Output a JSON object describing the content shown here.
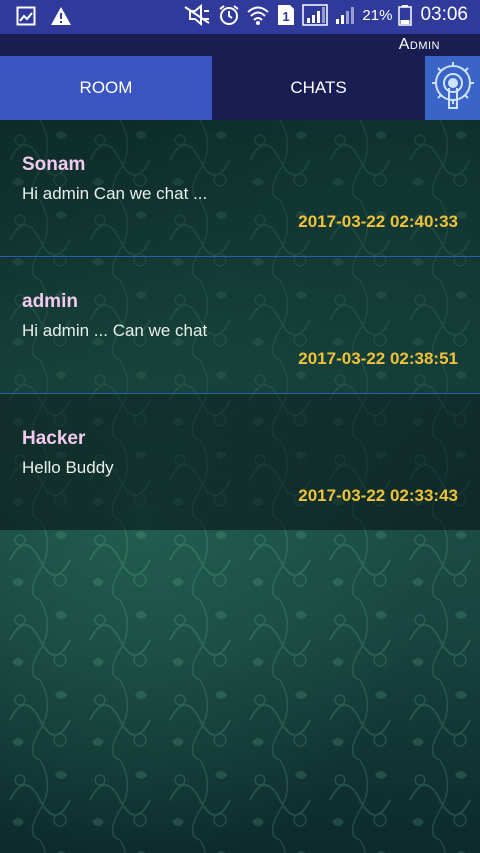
{
  "status_bar": {
    "battery_percent": "21%",
    "clock": "03:06",
    "sim_label": "1",
    "icons": [
      "image-notification-icon",
      "warning-icon",
      "mute-icon",
      "alarm-icon",
      "wifi-icon",
      "sim-icon",
      "signal-icon",
      "battery-icon"
    ]
  },
  "header": {
    "user_name": "Admin"
  },
  "tabs": [
    {
      "label": "ROOM",
      "active": true
    },
    {
      "label": "CHATS",
      "active": false
    }
  ],
  "settings": {
    "icon": "gear-settings-icon"
  },
  "chats": [
    {
      "name": "Sonam",
      "message": "Hi admin Can we chat ...",
      "time": "2017-03-22 02:40:33"
    },
    {
      "name": "admin",
      "message": "Hi admin ... Can we chat",
      "time": "2017-03-22 02:38:51"
    },
    {
      "name": "Hacker",
      "message": "Hello Buddy",
      "time": "2017-03-22 02:33:43"
    }
  ],
  "colors": {
    "status_bar": "#2f3a9a",
    "tab_active": "#3a54c2",
    "tab_inactive": "#1a1d52",
    "name_text": "#f2c9ef",
    "time_text": "#f0c23a",
    "divider": "#2f5fa8"
  }
}
